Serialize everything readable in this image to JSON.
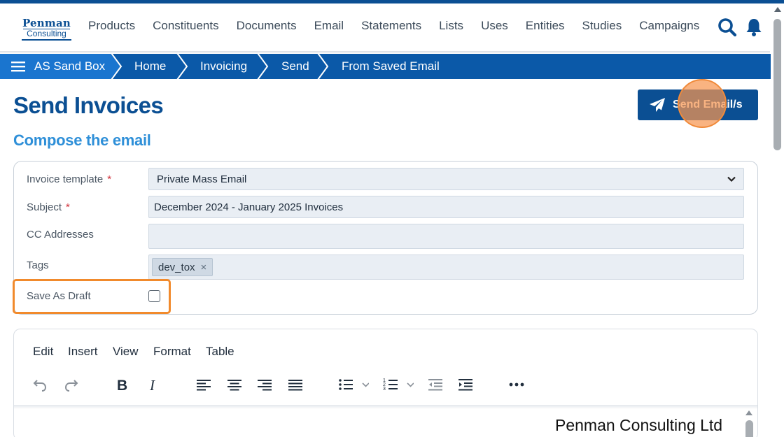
{
  "header": {
    "logo_line1": "Penman",
    "logo_line2": "Consulting",
    "nav": [
      "Products",
      "Constituents",
      "Documents",
      "Email",
      "Statements",
      "Lists",
      "Uses",
      "Entities",
      "Studies",
      "Campaigns"
    ],
    "icons": [
      "search-icon",
      "bell-icon"
    ]
  },
  "breadcrumb": {
    "root": "AS Sand Box",
    "items": [
      "Home",
      "Invoicing",
      "Send",
      "From Saved Email"
    ]
  },
  "page": {
    "title": "Send Invoices",
    "subtitle": "Compose the email",
    "send_button": "Send Email/s"
  },
  "form": {
    "invoice_template": {
      "label": "Invoice template",
      "required": "*",
      "value": "Private Mass Email"
    },
    "subject": {
      "label": "Subject",
      "required": "*",
      "value": "December 2024 - January 2025 Invoices"
    },
    "cc": {
      "label": "CC Addresses",
      "value": ""
    },
    "tags": {
      "label": "Tags",
      "items": [
        "dev_tox"
      ],
      "remove_glyph": "×"
    },
    "save_as_draft": {
      "label": "Save As Draft",
      "checked": false
    }
  },
  "editor": {
    "menus": [
      "Edit",
      "Insert",
      "View",
      "Format",
      "Table"
    ],
    "toolbar": [
      "undo-icon",
      "redo-icon",
      "bold-icon",
      "italic-icon",
      "align-left-icon",
      "align-center-icon",
      "align-right-icon",
      "align-justify-icon",
      "bullet-list-icon",
      "numbered-list-icon",
      "outdent-icon",
      "indent-icon",
      "more-icon"
    ],
    "content_text": "Penman Consulting Ltd"
  },
  "colors": {
    "brand": "#0b4f93",
    "breadcrumb": "#0b59a8",
    "breadcrumb_root": "#1a75cf",
    "subtitle": "#2e8fd8",
    "highlight": "#f18a2c",
    "required": "#d0303a"
  }
}
